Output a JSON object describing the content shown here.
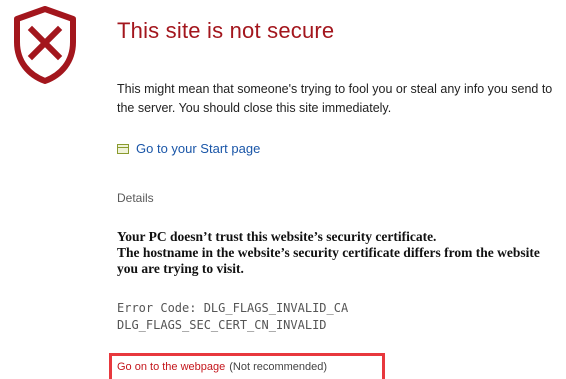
{
  "warning": {
    "icon": "shield-x-icon",
    "title": "This site is not secure",
    "message": "This might mean that someone's trying to fool you or steal any info you send to the server. You should close this site immediately."
  },
  "start_link": {
    "icon": "home-page-icon",
    "label": "Go to your Start page"
  },
  "details": {
    "toggle_label": "Details",
    "trust_heading": "Your PC doesn’t trust this website’s security certificate.",
    "hostname_message": "The hostname in the website’s security certificate differs from the website you are trying to visit.",
    "error_code_line1": "Error Code: DLG_FLAGS_INVALID_CA",
    "error_code_line2": "DLG_FLAGS_SEC_CERT_CN_INVALID"
  },
  "proceed": {
    "link_label": "Go on to the webpage",
    "note": "(Not recommended)"
  },
  "colors": {
    "danger": "#a3161d",
    "link": "#1a56a8",
    "highlight_box": "#e8383d"
  }
}
